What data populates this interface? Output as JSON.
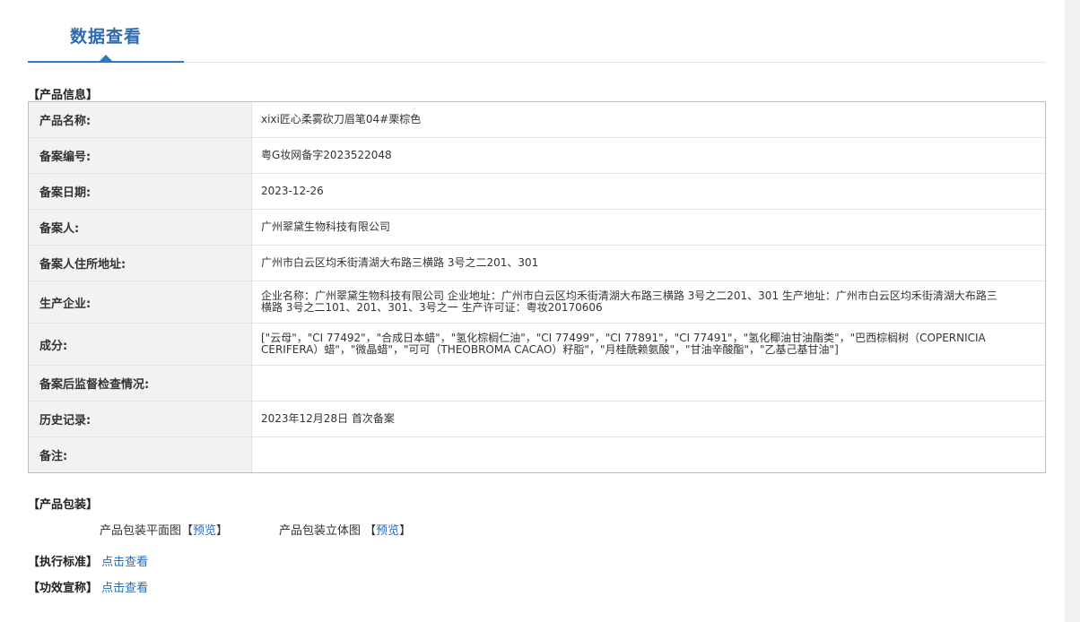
{
  "tab": {
    "title": "数据查看"
  },
  "product_info": {
    "section_title": "【产品信息】",
    "rows": [
      {
        "label": "产品名称:",
        "value": "xixi匠心柔雾砍刀眉笔04#栗棕色"
      },
      {
        "label": "备案编号:",
        "value": "粤G妆网备字2023522048"
      },
      {
        "label": "备案日期:",
        "value": "2023-12-26"
      },
      {
        "label": "备案人:",
        "value": "广州翠黛生物科技有限公司"
      },
      {
        "label": "备案人住所地址:",
        "value": "广州市白云区均禾街清湖大布路三横路 3号之二201、301"
      },
      {
        "label": "生产企业:",
        "value": "企业名称：广州翠黛生物科技有限公司 企业地址：广州市白云区均禾街清湖大布路三横路 3号之二201、301 生产地址：广州市白云区均禾街清湖大布路三横路 3号之二101、201、301、3号之一 生产许可证：粤妆20170606"
      },
      {
        "label": "成分:",
        "value": "[\"云母\"，\"CI 77492\"，\"合成日本蜡\"，\"氢化棕榈仁油\"，\"CI 77499\"，\"CI 77891\"，\"CI 77491\"，\"氢化椰油甘油酯类\"，\"巴西棕榈树（COPERNICIA CERIFERA）蜡\"，\"微晶蜡\"，\"可可（THEOBROMA CACAO）籽脂\"，\"月桂酰赖氨酸\"，\"甘油辛酸酯\"，\"乙基己基甘油\"]"
      },
      {
        "label": "备案后监督检查情况:",
        "value": ""
      },
      {
        "label": "历史记录:",
        "value": "2023年12月28日 首次备案"
      },
      {
        "label": "备注:",
        "value": ""
      }
    ]
  },
  "packaging": {
    "section_title": "【产品包装】",
    "flat_label": "产品包装平面图",
    "solid_label": "产品包装立体图",
    "bracket_open": "【",
    "bracket_close": "】",
    "preview_link": "预览"
  },
  "standard": {
    "label": "【执行标准】",
    "link": "点击查看"
  },
  "efficacy": {
    "label": "【功效宣称】",
    "link": "点击查看"
  }
}
